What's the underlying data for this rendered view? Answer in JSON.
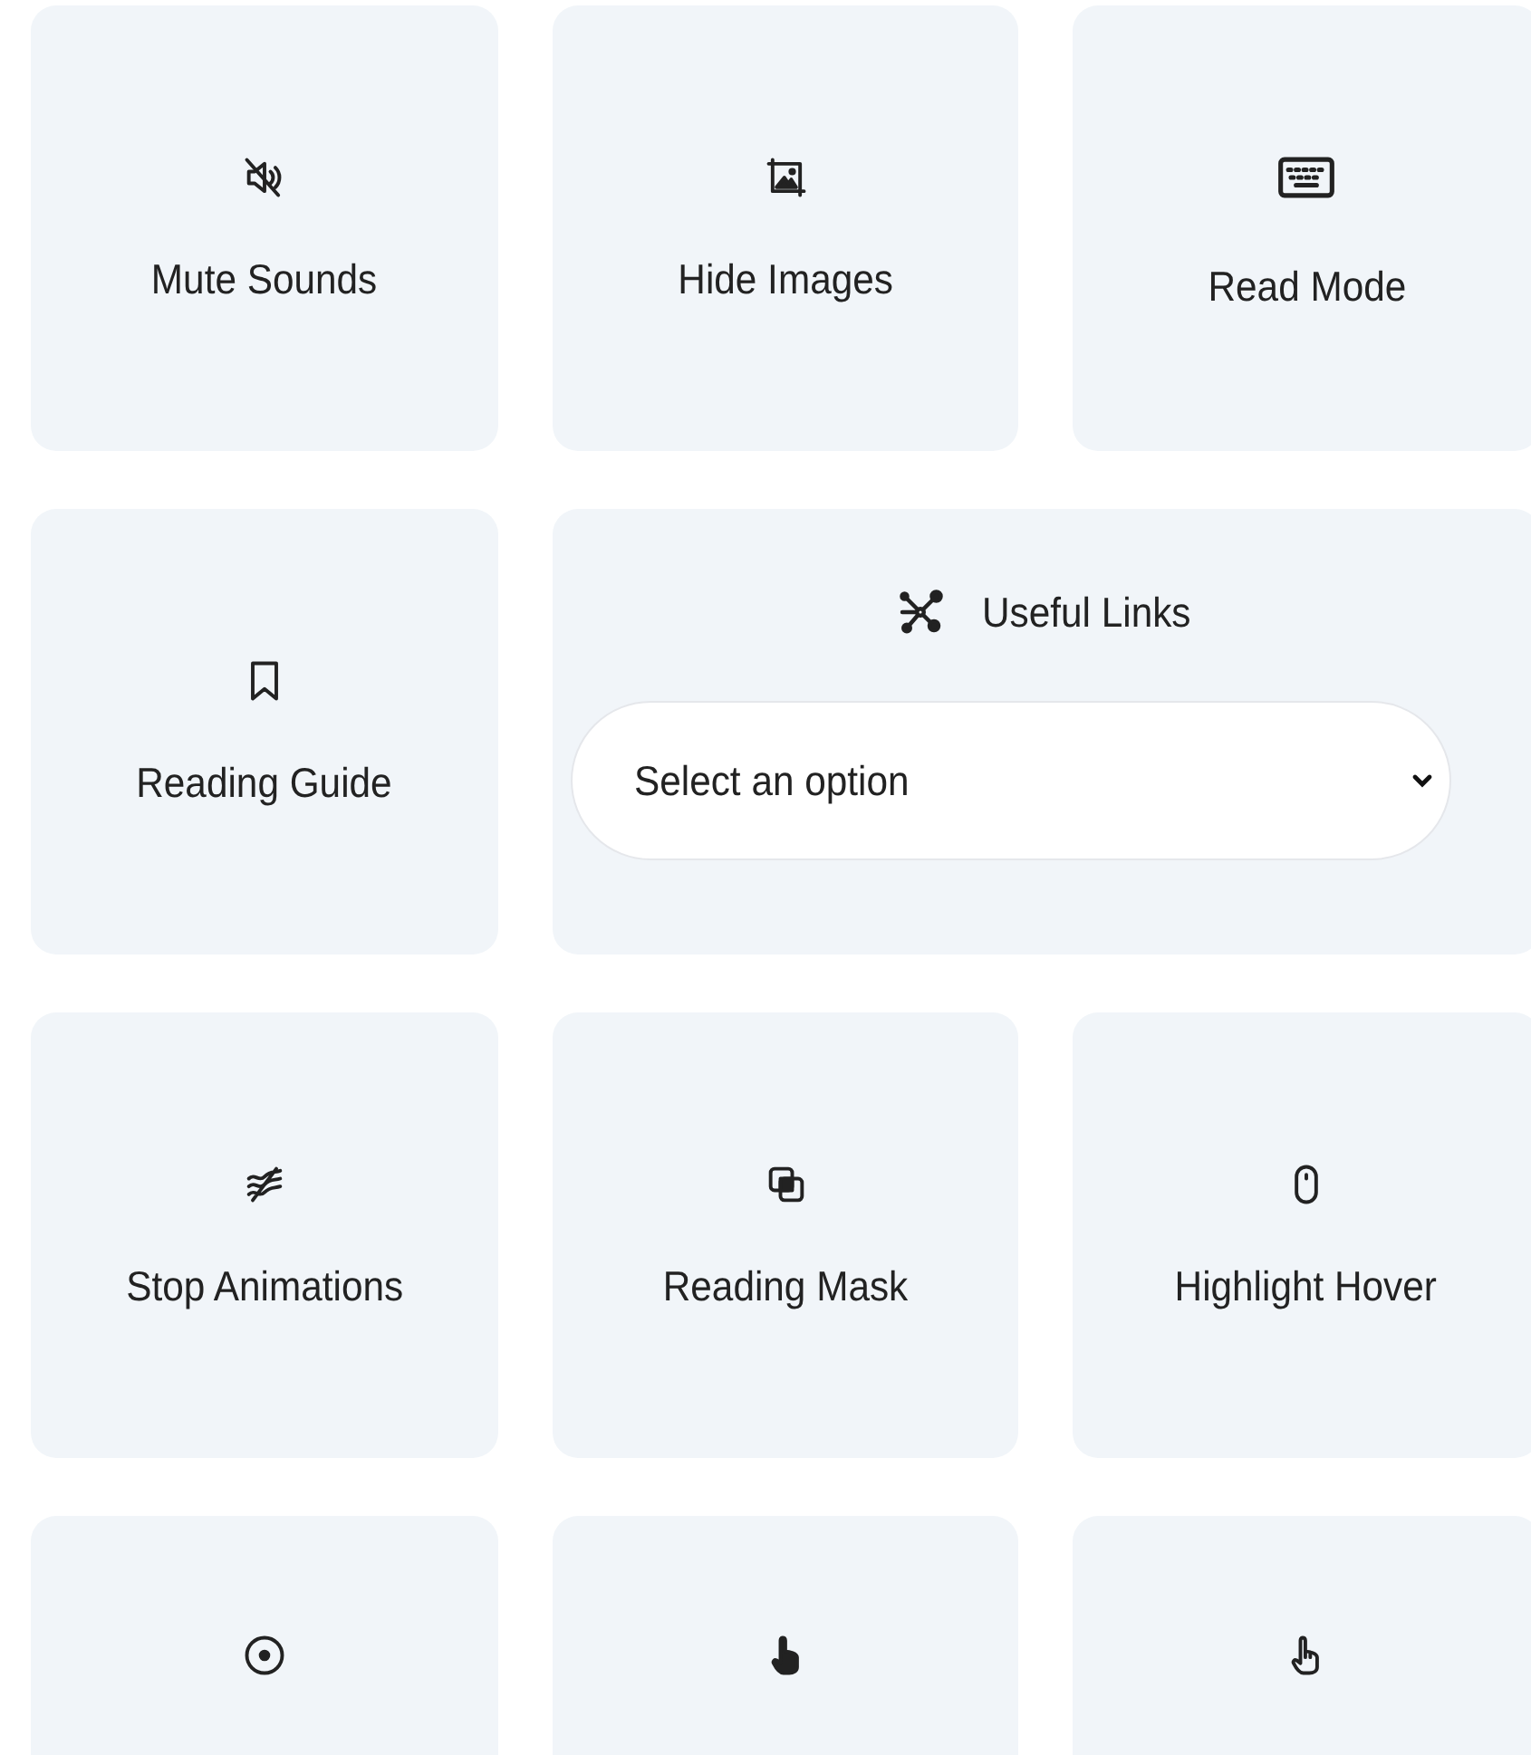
{
  "cards": [
    {
      "kind": "toggle",
      "label": "Mute Sounds"
    },
    {
      "kind": "toggle",
      "label": "Hide Images"
    },
    {
      "kind": "toggle",
      "label": "Read Mode"
    },
    {
      "kind": "toggle",
      "label": "Reading Guide"
    },
    {
      "kind": "dropdown",
      "label": "Useful Links",
      "placeholder": "Select an option"
    },
    {
      "kind": "toggle",
      "label": "Stop Animations"
    },
    {
      "kind": "toggle",
      "label": "Reading Mask"
    },
    {
      "kind": "toggle",
      "label": "Highlight Hover"
    },
    {
      "kind": "toggle"
    },
    {
      "kind": "toggle"
    },
    {
      "kind": "toggle"
    }
  ]
}
